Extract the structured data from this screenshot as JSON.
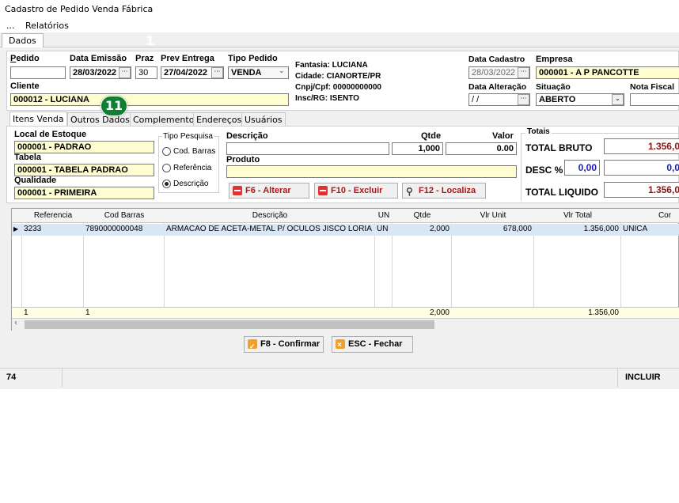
{
  "window": {
    "title": "Cadastro de Pedido Venda Fábrica"
  },
  "menu": {
    "ellipsis": "...",
    "relatorios": "Relatórios"
  },
  "top_tab": "Dados",
  "header": {
    "pedido_label": "Pedido",
    "pedido_value": "",
    "data_emissao_label": "Data Emissão",
    "data_emissao_value": "28/03/2022",
    "praz_label": "Praz",
    "praz_value": "30",
    "prev_entrega_label": "Prev Entrega",
    "prev_entrega_value": "27/04/2022",
    "tipo_pedido_label": "Tipo Pedido",
    "tipo_pedido_value": "VENDA",
    "cliente_label": "Cliente",
    "cliente_value": "000012 - LUCIANA",
    "fantasia": "Fantasia: LUCIANA",
    "cidade": "Cidade:   CIANORTE/PR",
    "cnpj": "Cnpj/Cpf: 00000000000",
    "insc": "Insc/RG:  ISENTO",
    "data_cadastro_label": "Data Cadastro",
    "data_cadastro_value": "28/03/2022",
    "data_alteracao_label": "Data Alteração",
    "data_alteracao_value": " / /",
    "empresa_label": "Empresa",
    "empresa_value": "000001 - A P PANCOTTE",
    "situacao_label": "Situação",
    "situacao_value": "ABERTO",
    "nota_fiscal_label": "Nota Fiscal",
    "nota_fiscal_value": "",
    "ellipsis": "···"
  },
  "subtabs": [
    "Itens Venda",
    "Outros Dados",
    "Complemento",
    "Endereços",
    "Usuários"
  ],
  "itens": {
    "local_estoque_label": "Local de Estoque",
    "local_estoque_value": "000001 - PADRAO",
    "tabela_label": "Tabela",
    "tabela_value": "000001 - TABELA PADRAO",
    "qualidade_label": "Qualidade",
    "qualidade_value": "000001 - PRIMEIRA",
    "tipo_pesquisa_label": "Tipo Pesquisa",
    "radios": [
      "Cod. Barras",
      "Referência",
      "Descrição"
    ],
    "descricao_label": "Descrição",
    "descricao_value": "",
    "qtde_label": "Qtde",
    "qtde_value": "1,000",
    "valor_label": "Valor",
    "valor_value": "0.00",
    "produto_label": "Produto",
    "produto_value": "",
    "btn_alterar": "F6 - Alterar",
    "btn_excluir": "F10 - Excluir",
    "btn_localiza": "F12 - Localiza"
  },
  "totais": {
    "group_label": "Totais",
    "total_bruto_label": "TOTAL BRUTO",
    "total_bruto_value": "1.356,0",
    "desc_label": "DESC %",
    "desc_pct_value": "0,00",
    "desc_val_value": "0,0",
    "total_liquido_label": "TOTAL LIQUIDO",
    "total_liquido_value": "1.356,0"
  },
  "grid": {
    "headers": [
      "Referencia",
      "Cod Barras",
      "Descrição",
      "UN",
      "Qtde",
      "Vlr Unit",
      "Vlr Total",
      "Cor"
    ],
    "rows": [
      {
        "referencia": "3233",
        "cod_barras": "7890000000048",
        "descricao": "ARMACAO DE ACETA-METAL P/ OCULOS JISCO LORIA",
        "un": "UN",
        "qtde": "2,000",
        "vlr_unit": "678,000",
        "vlr_total": "1.356,000",
        "cor": "UNICA"
      }
    ],
    "footer": {
      "referencia": "1",
      "cod_barras": "1",
      "qtde": "2,000",
      "vlr_total": "1.356,00"
    }
  },
  "actions": {
    "confirmar": "F8 - Confirmar",
    "fechar": "ESC - Fechar"
  },
  "status": {
    "left": "74",
    "right": "INCLUIR"
  },
  "annotation": {
    "badge": "11",
    "ghost": "1"
  },
  "colors": {
    "input_yellow": "#fffdd0",
    "badge_green": "#0e7f33",
    "selected_row": "#d9e6f4",
    "accent_red": "#b01515"
  }
}
